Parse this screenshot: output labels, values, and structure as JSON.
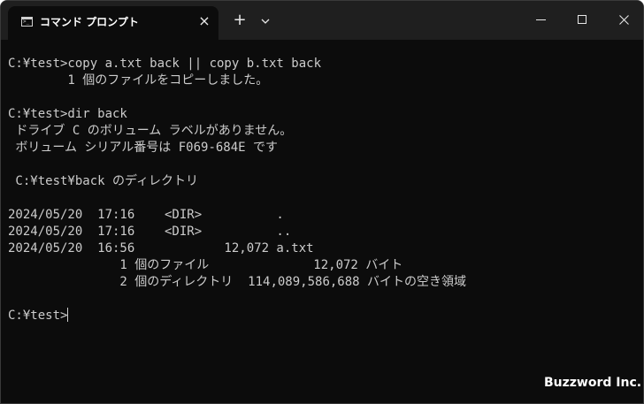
{
  "window": {
    "tab_title": "コマンド プロンプト",
    "close_tab_symbol": "×",
    "new_tab_symbol": "+",
    "icons": {
      "tab": "terminal-icon",
      "close": "close-icon",
      "new_tab": "plus-icon",
      "dropdown": "chevron-down-icon",
      "minimize": "minimize-icon",
      "maximize": "maximize-icon",
      "window_close": "close-icon"
    },
    "colors": {
      "background": "#0c0c0c",
      "titlebar": "#1f1f1f",
      "text": "#cccccc"
    }
  },
  "terminal": {
    "lines": [
      "C:¥test>copy a.txt back || copy b.txt back",
      "        1 個のファイルをコピーしました。",
      "",
      "C:¥test>dir back",
      " ドライブ C のボリューム ラベルがありません。",
      " ボリューム シリアル番号は F069-684E です",
      "",
      " C:¥test¥back のディレクトリ",
      "",
      "2024/05/20  17:16    <DIR>          .",
      "2024/05/20  17:16    <DIR>          ..",
      "2024/05/20  16:56            12,072 a.txt",
      "               1 個のファイル              12,072 バイト",
      "               2 個のディレクトリ  114,089,586,688 バイトの空き領域",
      "",
      "C:¥test>"
    ]
  },
  "watermark": "Buzzword Inc."
}
